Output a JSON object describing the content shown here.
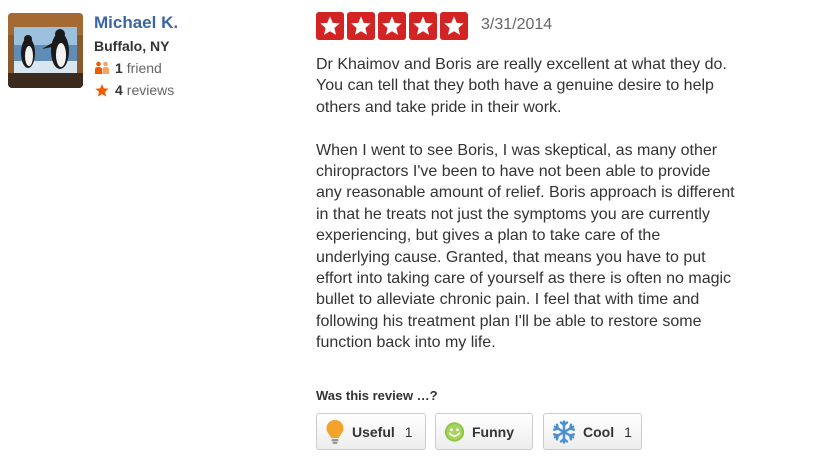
{
  "user": {
    "name": "Michael K.",
    "location": "Buffalo, NY",
    "friends_count": "1",
    "friends_label": "friend",
    "reviews_count": "4",
    "reviews_label": "reviews",
    "avatar_icon": "penguins-photo"
  },
  "review": {
    "rating": 5,
    "rating_max": 5,
    "date": "3/31/2014",
    "text": "Dr Khaimov and Boris are really excellent at what they do.\nYou can tell that they both have a genuine desire to help\nothers and take pride in their work.\n\nWhen I went to see Boris, I was skeptical, as many other\nchiropractors I've been to have not been able to provide\nany reasonable amount of relief. Boris approach is different\nin that he treats not just the symptoms you are currently\nexperiencing, but gives a plan to take care of the\nunderlying cause.  Granted, that means you have to put\neffort into taking care of yourself as there is often no magic\nbullet to alleviate chronic pain.  I feel that with time and\nfollowing his treatment plan I'll be able to restore some\nfunction back into my life."
  },
  "feedback": {
    "question": "Was this review …?",
    "useful": {
      "label": "Useful",
      "count": "1",
      "icon": "lightbulb-icon"
    },
    "funny": {
      "label": "Funny",
      "count": "",
      "icon": "smiley-icon"
    },
    "cool": {
      "label": "Cool",
      "count": "1",
      "icon": "snowflake-icon"
    }
  },
  "colors": {
    "star_red": "#d32323",
    "user_link": "#3a66a5",
    "useful_icon": "#f3a32a",
    "funny_icon": "#8cc63f",
    "cool_icon": "#4a8fd1"
  }
}
